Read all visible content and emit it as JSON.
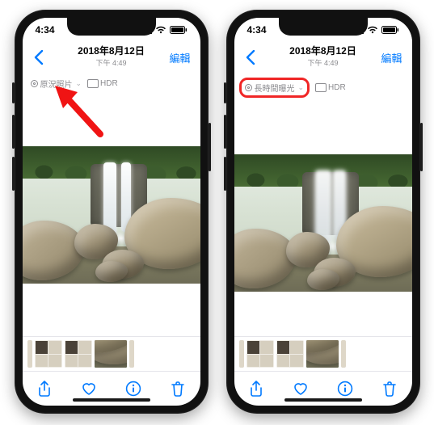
{
  "status": {
    "time": "4:34"
  },
  "nav": {
    "date": "2018年8月12日",
    "time": "下午 4:49",
    "edit": "編輯"
  },
  "badges": {
    "live_original": "原況照片",
    "live_longexp": "長時間曝光",
    "hdr": "HDR"
  },
  "colors": {
    "accent": "#007aff",
    "highlight": "#f02626"
  }
}
